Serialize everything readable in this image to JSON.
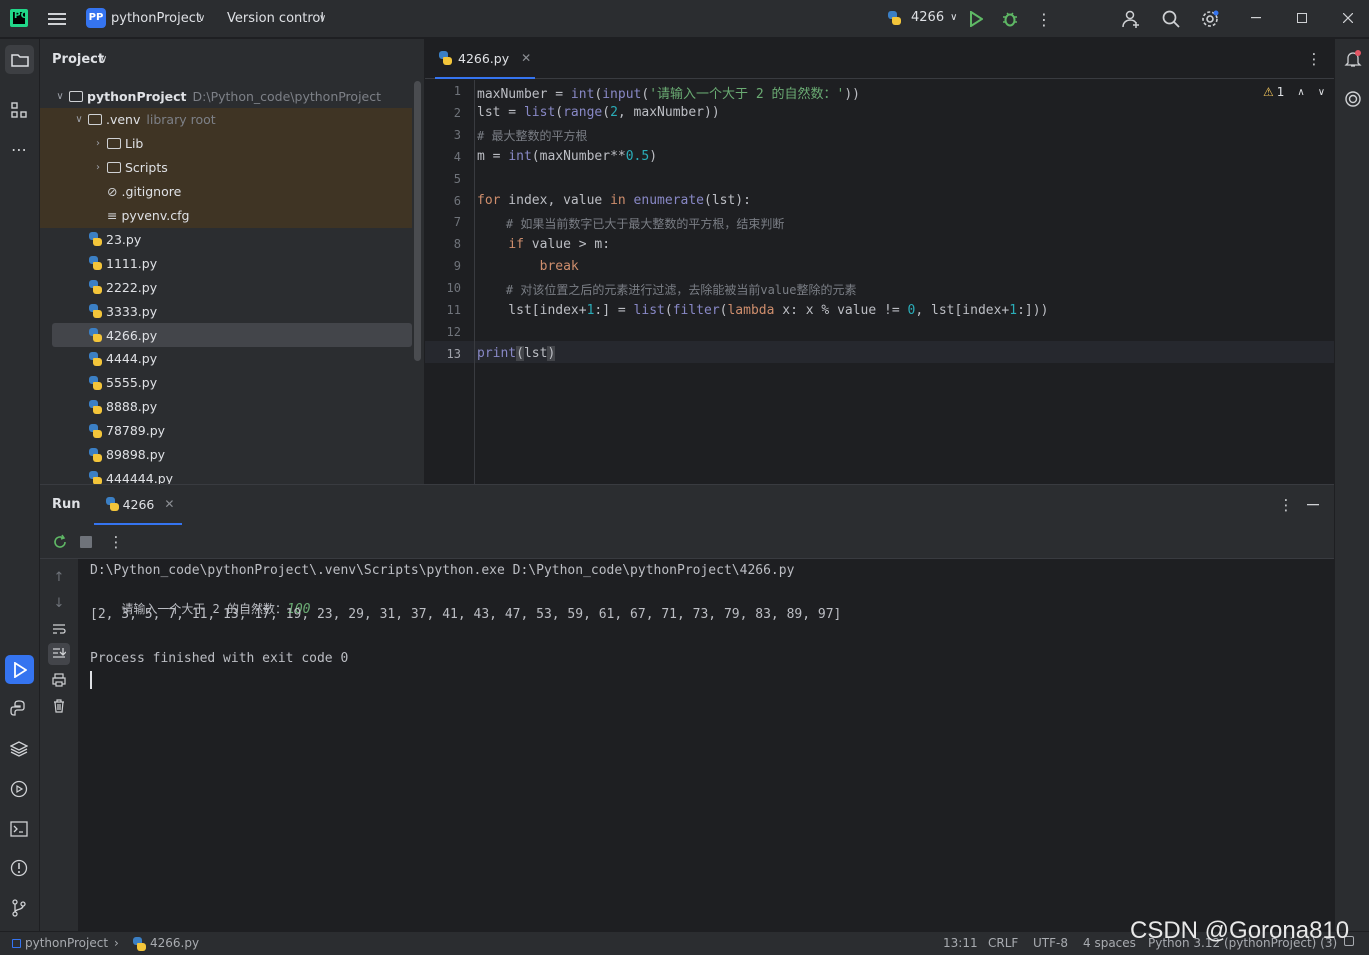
{
  "titlebar": {
    "project_badge": "PP",
    "project_name": "pythonProject",
    "vcs": "Version control",
    "run_config": "4266"
  },
  "project_panel": {
    "title": "Project",
    "items": [
      {
        "label": "pythonProject",
        "extra": "D:\\Python_code\\pythonProject",
        "type": "folder",
        "depth": 0,
        "expanded": true
      },
      {
        "label": ".venv",
        "extra": "library root",
        "type": "folder",
        "depth": 1,
        "expanded": true
      },
      {
        "label": "Lib",
        "extra": "",
        "type": "folder",
        "depth": 2,
        "expanded": false
      },
      {
        "label": "Scripts",
        "extra": "",
        "type": "folder",
        "depth": 2,
        "expanded": false
      },
      {
        "label": ".gitignore",
        "extra": "",
        "type": "ignore",
        "depth": 2
      },
      {
        "label": "pyvenv.cfg",
        "extra": "",
        "type": "cfg",
        "depth": 2
      },
      {
        "label": "23.py",
        "extra": "",
        "type": "py",
        "depth": 1
      },
      {
        "label": "1111.py",
        "extra": "",
        "type": "py",
        "depth": 1
      },
      {
        "label": "2222.py",
        "extra": "",
        "type": "py",
        "depth": 1
      },
      {
        "label": "3333.py",
        "extra": "",
        "type": "py",
        "depth": 1
      },
      {
        "label": "4266.py",
        "extra": "",
        "type": "py",
        "depth": 1,
        "selected": true
      },
      {
        "label": "4444.py",
        "extra": "",
        "type": "py",
        "depth": 1
      },
      {
        "label": "5555.py",
        "extra": "",
        "type": "py",
        "depth": 1
      },
      {
        "label": "8888.py",
        "extra": "",
        "type": "py",
        "depth": 1
      },
      {
        "label": "78789.py",
        "extra": "",
        "type": "py",
        "depth": 1
      },
      {
        "label": "89898.py",
        "extra": "",
        "type": "py",
        "depth": 1
      },
      {
        "label": "444444.py",
        "extra": "",
        "type": "py",
        "depth": 1
      }
    ]
  },
  "editor": {
    "tab_label": "4266.py",
    "warning_count": "1",
    "line_numbers": [
      "1",
      "2",
      "3",
      "4",
      "5",
      "6",
      "7",
      "8",
      "9",
      "10",
      "11",
      "12",
      "13"
    ]
  },
  "run_panel": {
    "title": "Run",
    "tab_label": "4266",
    "output": [
      "D:\\Python_code\\pythonProject\\.venv\\Scripts\\python.exe D:\\Python_code\\pythonProject\\4266.py",
      "请输入一个大于 2 的自然数：",
      "100",
      "[2, 3, 5, 7, 11, 13, 17, 19, 23, 29, 31, 37, 41, 43, 47, 53, 59, 61, 67, 71, 73, 79, 83, 89, 97]",
      "Process finished with exit code 0"
    ]
  },
  "statusbar": {
    "breadcrumb_project": "pythonProject",
    "breadcrumb_file": "4266.py",
    "position": "13:11",
    "line_sep": "CRLF",
    "encoding": "UTF-8",
    "indent": "4 spaces",
    "interpreter": "Python 3.12 (pythonProject) (3)"
  },
  "watermark": "CSDN @Gorona810",
  "colors": {
    "accent": "#3574f0",
    "keyword": "#cf8e6d",
    "string": "#6aab73",
    "number": "#2aacb8",
    "comment": "#7a7e85"
  }
}
